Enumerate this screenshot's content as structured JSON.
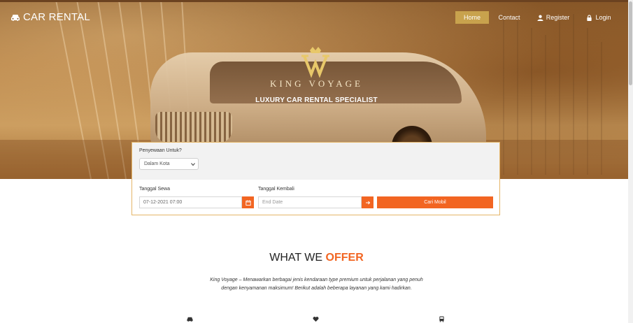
{
  "brand": {
    "name": "CAR RENTAL",
    "icon": "car-icon"
  },
  "nav": {
    "home": "Home",
    "contact": "Contact",
    "register": "Register",
    "login": "Login",
    "active_color": "#c8a24d"
  },
  "hero": {
    "logo_text": "KING VOYAGE",
    "tagline": "LUXURY CAR RENTAL SPECIALIST"
  },
  "search": {
    "tujuan_label": "Penyewaan Untuk?",
    "tujuan_value": "Dalam Kota",
    "sewa_label": "Tanggal Sewa",
    "sewa_value": "07-12-2021 07:00",
    "kembali_label": "Tanggal Kembali",
    "kembali_placeholder": "End Date",
    "submit_label": "Cari Mobil",
    "accent_color": "#f26522"
  },
  "offer": {
    "title_plain": "WHAT WE",
    "title_accent": "OFFER",
    "description": "King Voyage – Menawarkan berbagai jenis kendaraan type premium untuk perjalanan yang penuh dengan kenyamanan maksimum! Berikut adalah beberapa layanan yang kami hadirkan.",
    "feature_icons": [
      "car-icon",
      "heart-icon",
      "bus-icon"
    ]
  }
}
